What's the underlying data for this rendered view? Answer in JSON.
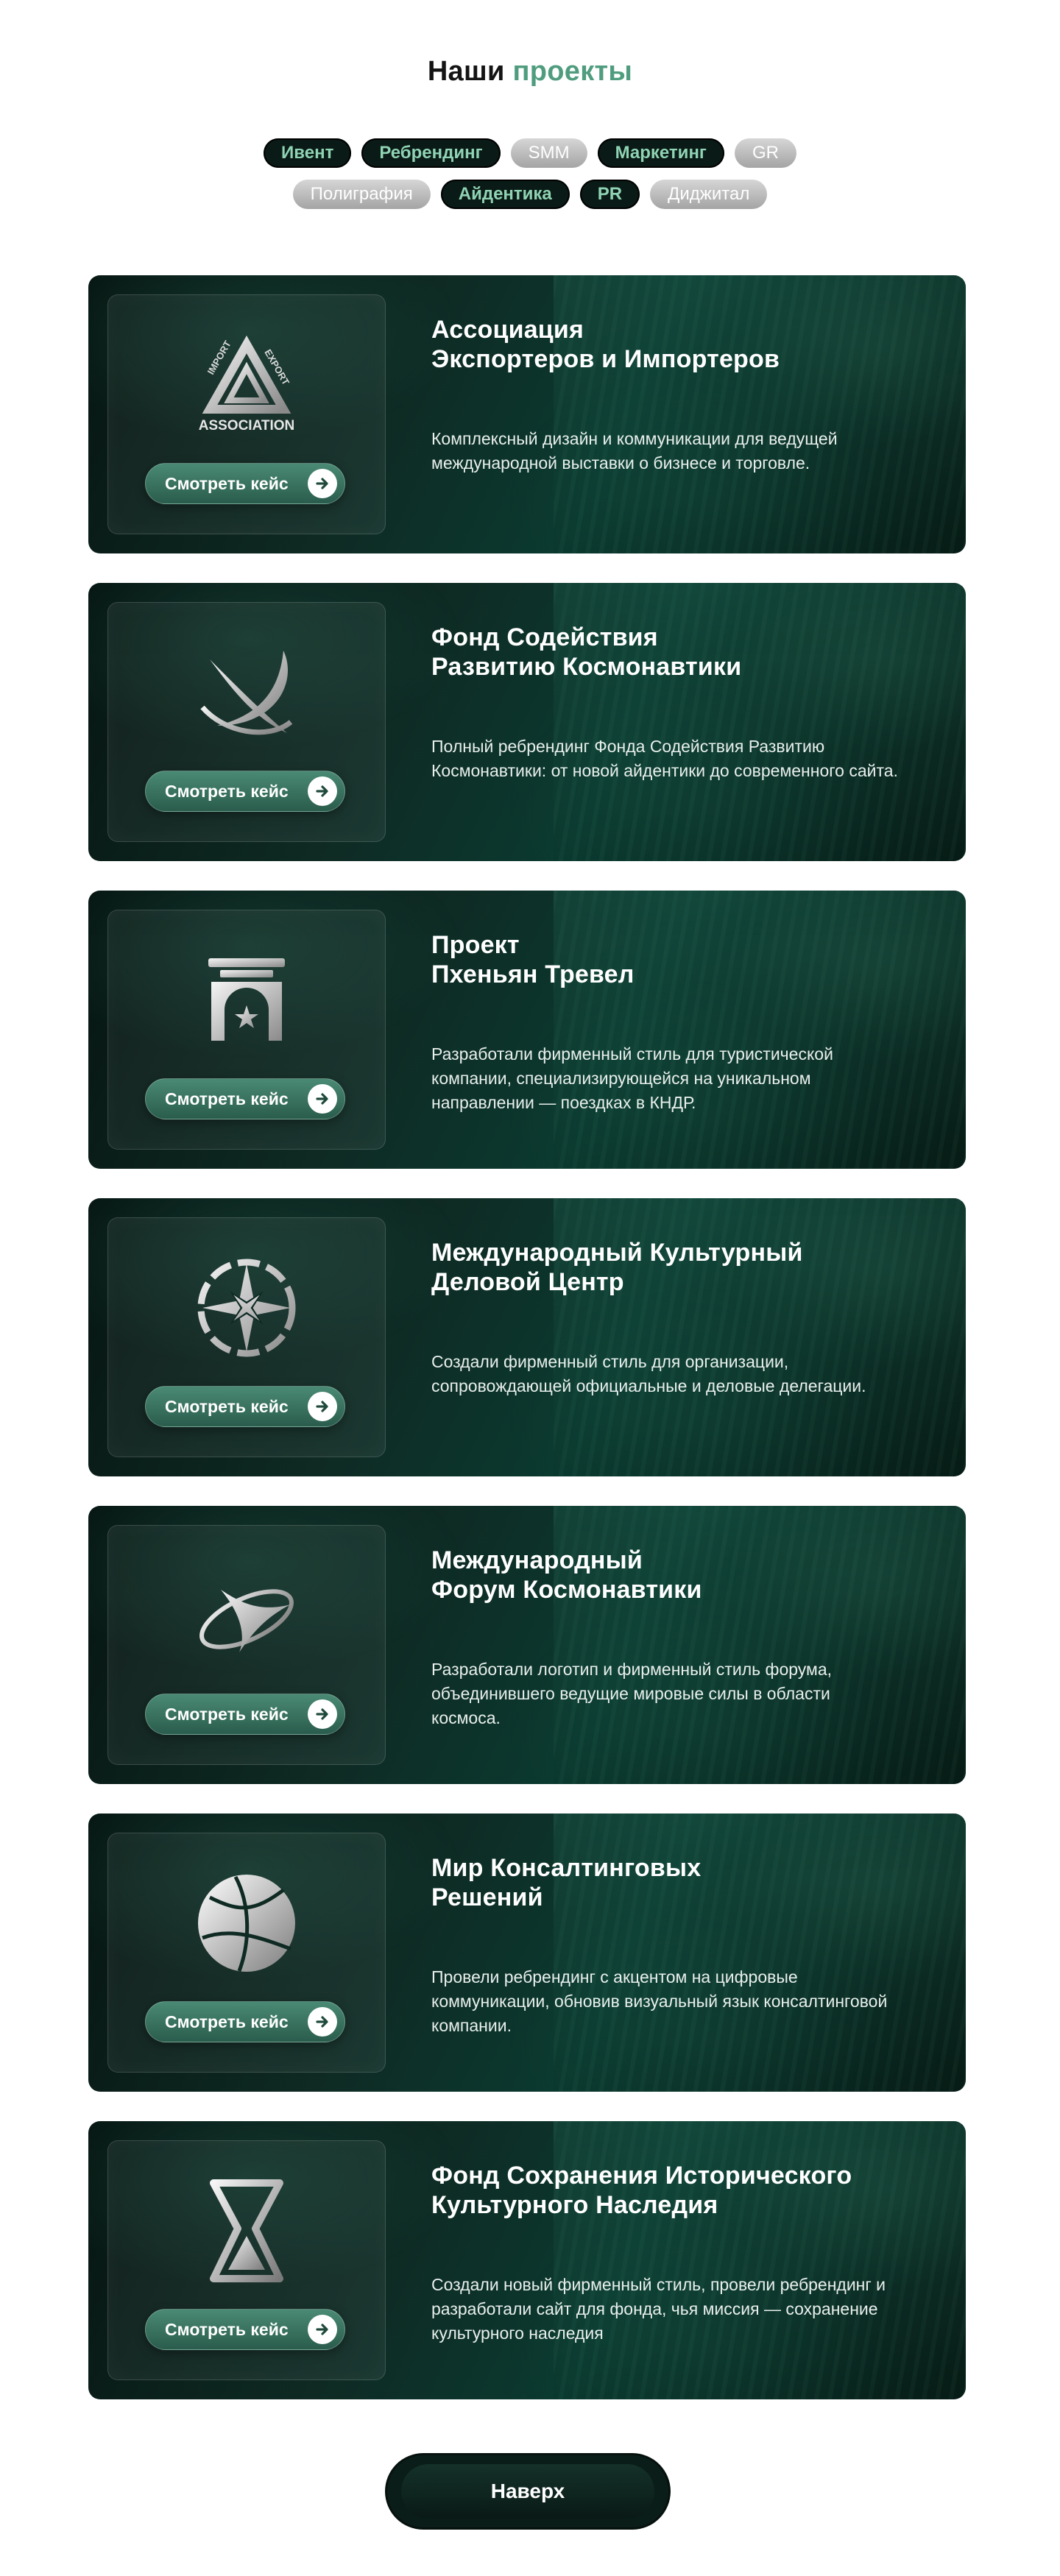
{
  "header": {
    "title_plain": "Наши",
    "title_accent": "проекты"
  },
  "filters": {
    "row1": [
      {
        "label": "Ивент",
        "active": true
      },
      {
        "label": "Ребрендинг",
        "active": true
      },
      {
        "label": "SMM",
        "active": false
      },
      {
        "label": "Маркетинг",
        "active": true
      },
      {
        "label": "GR",
        "active": false
      }
    ],
    "row2": [
      {
        "label": "Полиграфия",
        "active": false
      },
      {
        "label": "Айдентика",
        "active": true
      },
      {
        "label": "PR",
        "active": true
      },
      {
        "label": "Диджитал",
        "active": false
      }
    ]
  },
  "cards": [
    {
      "title_line1": "Ассоциация",
      "title_line2": "Экспортеров и Импортеров",
      "description": "Комплексный дизайн и коммуникации для ведущей международной выставки о бизнесе и торговле.",
      "button": "Смотреть кейс",
      "logo_icon": "import-export-association-logo-icon",
      "logo_text_1": "IMPORT",
      "logo_text_2": "EXPORT",
      "logo_text_3": "ASSOCIATION"
    },
    {
      "title_line1": "Фонд Содействия",
      "title_line2": "Развитию Космонавтики",
      "description": "Полный ребрендинг Фонда Содействия Развитию Космонавтики: от новой айдентики до современного сайта.",
      "button": "Смотреть кейс",
      "logo_icon": "cosmonautics-fund-logo-icon"
    },
    {
      "title_line1": "Проект",
      "title_line2": "Пхеньян Тревел",
      "description": "Разработали фирменный стиль для туристической компании, специализирующейся на уникальном направлении — поездках в КНДР.",
      "button": "Смотреть кейс",
      "logo_icon": "pyongyang-travel-logo-icon"
    },
    {
      "title_line1": "Международный Культурный",
      "title_line2": "Деловой Центр",
      "description": "Создали фирменный стиль для организации, сопровождающей официальные и деловые делегации.",
      "button": "Смотреть кейс",
      "logo_icon": "compass-star-logo-icon"
    },
    {
      "title_line1": "Международный",
      "title_line2": "Форум Космонавтики",
      "description": "Разработали логотип и фирменный стиль форума, объединившего ведущие мировые силы в области космоса.",
      "button": "Смотреть кейс",
      "logo_icon": "space-forum-logo-icon"
    },
    {
      "title_line1": "Мир Консалтинговых",
      "title_line2": "Решений",
      "description": "Провели ребрендинг с акцентом на цифровые коммуникации, обновив визуальный язык консалтинговой компании.",
      "button": "Смотреть кейс",
      "logo_icon": "sphere-logo-icon"
    },
    {
      "title_line1": "Фонд Сохранения Исторического",
      "title_line2": "Культурного Наследия",
      "description": "Создали новый фирменный стиль, провели ребрендинг и разработали сайт для фонда, чья миссия — сохранение культурного наследия",
      "button": "Смотреть кейс",
      "logo_icon": "hourglass-logo-icon"
    }
  ],
  "footer": {
    "top_button": "Наверх"
  },
  "colors": {
    "accent": "#4f9d7e",
    "chip_active_bg": "#0a1a16",
    "chip_active_text": "#8fd3b4",
    "card_bg": "#0e2a23"
  }
}
